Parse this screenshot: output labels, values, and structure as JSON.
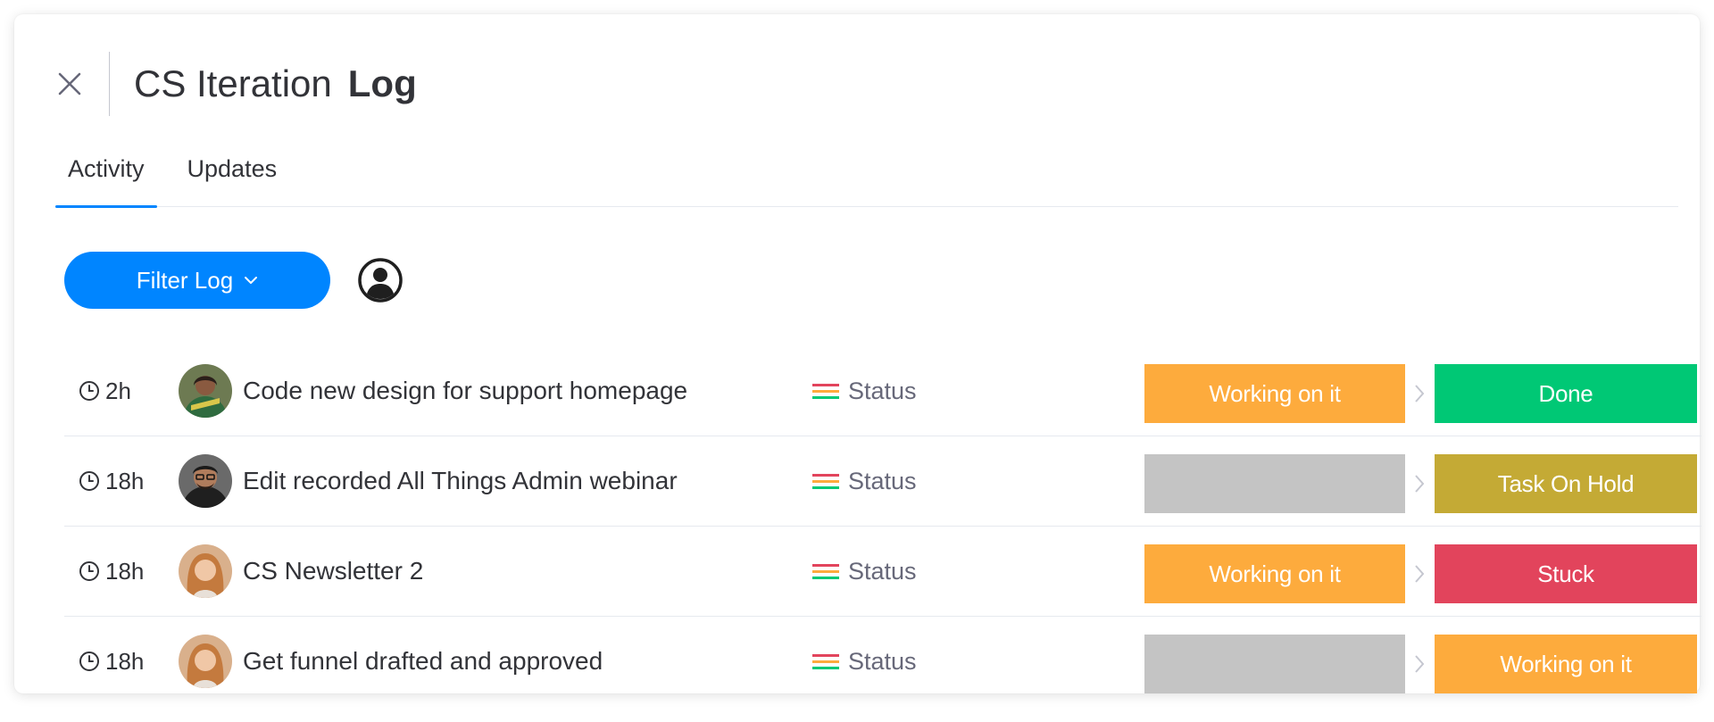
{
  "header": {
    "title_light": "CS Iteration",
    "title_bold": "Log"
  },
  "tabs": [
    {
      "label": "Activity",
      "active": true
    },
    {
      "label": "Updates",
      "active": false
    }
  ],
  "toolbar": {
    "filter_label": "Filter Log"
  },
  "icons": {
    "close": "close-icon",
    "person": "person-icon",
    "clock": "clock-icon",
    "status_column": "status-column-icon",
    "arrow": "chevron-right-icon"
  },
  "colors": {
    "accent": "#0085ff",
    "working_on_it": "#fdab3d",
    "done": "#00c875",
    "stuck": "#e2445c",
    "task_on_hold": "#c4aa35",
    "empty": "#c4c4c4"
  },
  "activity": [
    {
      "time": "2h",
      "item": "Code new design for support homepage",
      "column": "Status",
      "from": {
        "label": "Working on it",
        "color": "#fdab3d"
      },
      "to": {
        "label": "Done",
        "color": "#00c875"
      },
      "avatar": "avatar-1"
    },
    {
      "time": "18h",
      "item": "Edit recorded All Things Admin webinar",
      "column": "Status",
      "from": {
        "label": "",
        "color": "#c4c4c4"
      },
      "to": {
        "label": "Task On Hold",
        "color": "#c4aa35"
      },
      "avatar": "avatar-2"
    },
    {
      "time": "18h",
      "item": "CS Newsletter 2",
      "column": "Status",
      "from": {
        "label": "Working on it",
        "color": "#fdab3d"
      },
      "to": {
        "label": "Stuck",
        "color": "#e2445c"
      },
      "avatar": "avatar-3"
    },
    {
      "time": "18h",
      "item": "Get funnel drafted and approved",
      "column": "Status",
      "from": {
        "label": "",
        "color": "#c4c4c4"
      },
      "to": {
        "label": "Working on it",
        "color": "#fdab3d"
      },
      "avatar": "avatar-3"
    }
  ]
}
